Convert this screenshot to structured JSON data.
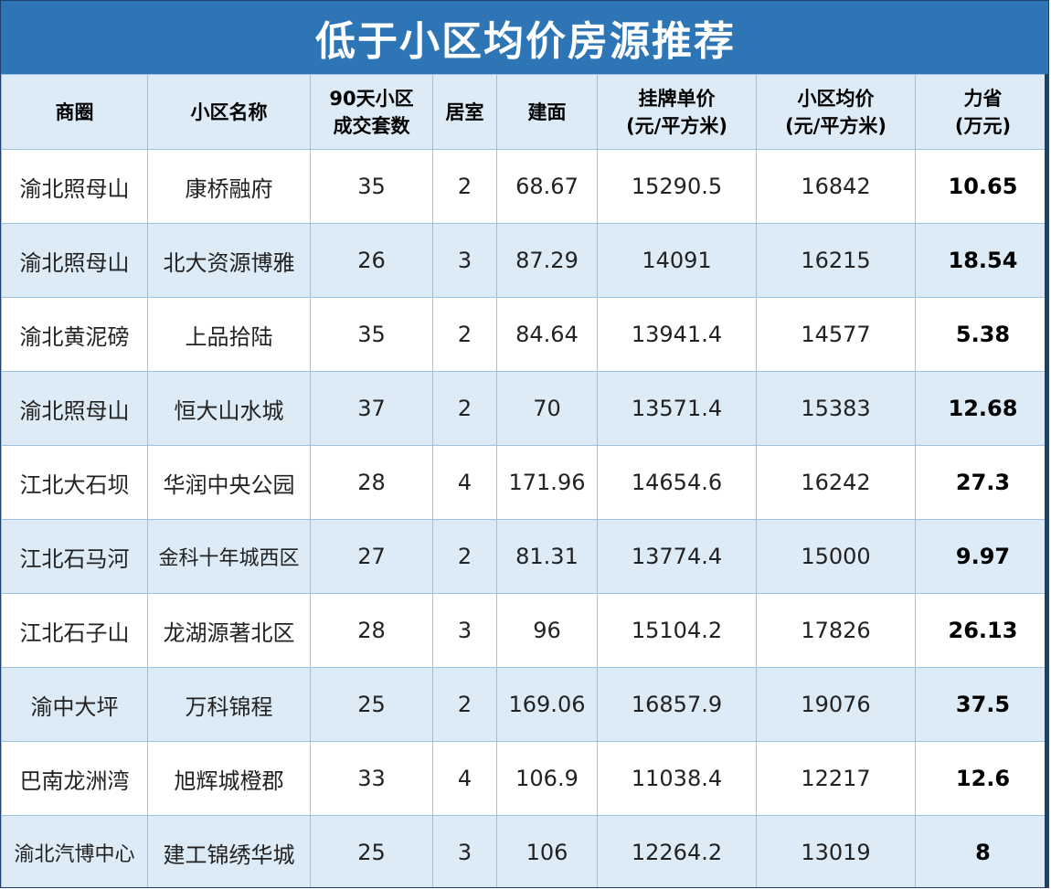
{
  "title": "低于小区均价房源推荐",
  "columns": [
    {
      "line1": "商圈",
      "line2": ""
    },
    {
      "line1": "小区名称",
      "line2": ""
    },
    {
      "line1": "90天小区",
      "line2": "成交套数"
    },
    {
      "line1": "居室",
      "line2": ""
    },
    {
      "line1": "建面",
      "line2": ""
    },
    {
      "line1": "挂牌单价",
      "line2": "(元/平方米)"
    },
    {
      "line1": "小区均价",
      "line2": "(元/平方米)"
    },
    {
      "line1": "力省",
      "line2": "(万元)"
    }
  ],
  "rows": [
    {
      "district": "渝北照母山",
      "community": "康桥融府",
      "deals": "35",
      "rooms": "2",
      "area": "68.67",
      "list_price": "15290.5",
      "avg_price": "16842",
      "saving": "10.65"
    },
    {
      "district": "渝北照母山",
      "community": "北大资源博雅",
      "deals": "26",
      "rooms": "3",
      "area": "87.29",
      "list_price": "14091",
      "avg_price": "16215",
      "saving": "18.54"
    },
    {
      "district": "渝北黄泥磅",
      "community": "上品拾陆",
      "deals": "35",
      "rooms": "2",
      "area": "84.64",
      "list_price": "13941.4",
      "avg_price": "14577",
      "saving": "5.38"
    },
    {
      "district": "渝北照母山",
      "community": "恒大山水城",
      "deals": "37",
      "rooms": "2",
      "area": "70",
      "list_price": "13571.4",
      "avg_price": "15383",
      "saving": "12.68"
    },
    {
      "district": "江北大石坝",
      "community": "华润中央公园",
      "deals": "28",
      "rooms": "4",
      "area": "171.96",
      "list_price": "14654.6",
      "avg_price": "16242",
      "saving": "27.3"
    },
    {
      "district": "江北石马河",
      "community": "金科十年城西区",
      "deals": "27",
      "rooms": "2",
      "area": "81.31",
      "list_price": "13774.4",
      "avg_price": "15000",
      "saving": "9.97"
    },
    {
      "district": "江北石子山",
      "community": "龙湖源著北区",
      "deals": "28",
      "rooms": "3",
      "area": "96",
      "list_price": "15104.2",
      "avg_price": "17826",
      "saving": "26.13"
    },
    {
      "district": "渝中大坪",
      "community": "万科锦程",
      "deals": "25",
      "rooms": "2",
      "area": "169.06",
      "list_price": "16857.9",
      "avg_price": "19076",
      "saving": "37.5"
    },
    {
      "district": "巴南龙洲湾",
      "community": "旭辉城橙郡",
      "deals": "33",
      "rooms": "4",
      "area": "106.9",
      "list_price": "11038.4",
      "avg_price": "12217",
      "saving": "12.6"
    },
    {
      "district": "渝北汽博中心",
      "community": "建工锦绣华城",
      "deals": "25",
      "rooms": "3",
      "area": "106",
      "list_price": "12264.2",
      "avg_price": "13019",
      "saving": "8"
    }
  ],
  "colors": {
    "title_bg": "#2e75b6",
    "header_bg": "#ddebf7",
    "stripe_bg": "#ddebf7",
    "border": "#9dbfe0"
  }
}
